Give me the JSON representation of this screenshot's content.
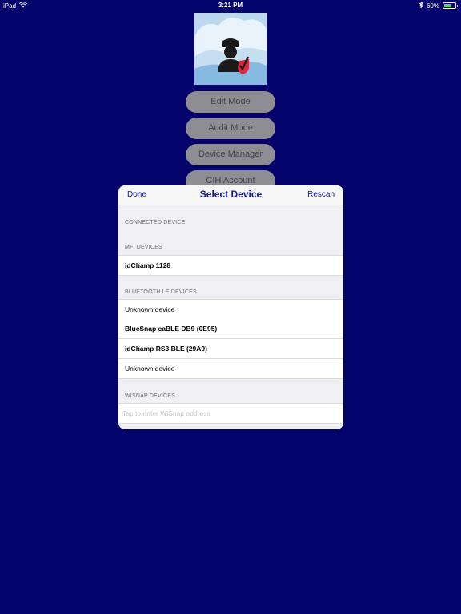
{
  "status_bar": {
    "device": "iPad",
    "time": "3:21 PM",
    "battery_percent": "60%",
    "battery_level": 0.6
  },
  "background_menu": {
    "buttons": [
      "Edit Mode",
      "Audit Mode",
      "Device Manager",
      "CIH Account"
    ]
  },
  "modal": {
    "done_label": "Done",
    "title": "Select Device",
    "rescan_label": "Rescan",
    "sections": {
      "connected_header": "CONNECTED DEVICE",
      "mfi_header": "MFI DEVICES",
      "mfi_items": [
        "idChamp 1128"
      ],
      "ble_header": "BLUETOOTH LE DEVICES",
      "ble_items": [
        "Unknown device",
        "BlueSnap caBLE DB9 (0E95)",
        "idChamp RS3 BLE (29A9)",
        "Unknown device"
      ],
      "wisnap_header": "WISNAP DEVICES",
      "wisnap_placeholder": "Tap to enter WiSnap address"
    }
  },
  "colors": {
    "background": "#03036b",
    "accent": "#0d1a9e",
    "logo_bg": "#bcd8ee",
    "check": "#e0263c"
  },
  "icons": {
    "wifi": "wifi-icon",
    "bluetooth": "bluetooth-icon",
    "battery": "battery-icon",
    "logo": "officer-checkmark-logo"
  }
}
